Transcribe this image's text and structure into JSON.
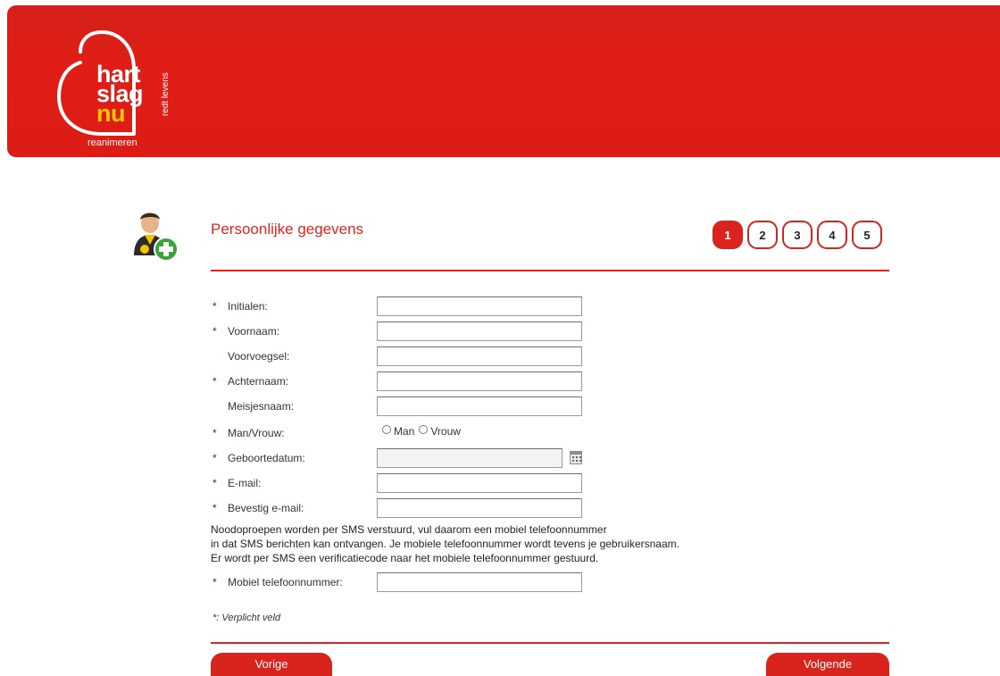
{
  "logo": {
    "line1": "hart",
    "line2": "slag",
    "line3": "nu",
    "subtitle": "reanimeren",
    "vertical": "redt levens",
    "icon": "heart-outline-logo"
  },
  "section": {
    "title": "Persoonlijke gegevens",
    "icon": "user-add-icon"
  },
  "steps": [
    "1",
    "2",
    "3",
    "4",
    "5"
  ],
  "active_step": "1",
  "form": {
    "fields": [
      {
        "required": "*",
        "label": "Initialen:",
        "value": ""
      },
      {
        "required": "*",
        "label": "Voornaam:",
        "value": ""
      },
      {
        "required": "",
        "label": "Voorvoegsel:",
        "value": ""
      },
      {
        "required": "*",
        "label": "Achternaam:",
        "value": ""
      },
      {
        "required": "",
        "label": "Meisjesnaam:",
        "value": ""
      }
    ],
    "gender": {
      "required": "*",
      "label": "Man/Vrouw:",
      "option_man": "Man",
      "option_vrouw": "Vrouw"
    },
    "birthdate": {
      "required": "*",
      "label": "Geboortedatum:",
      "value": "",
      "icon": "calendar-icon"
    },
    "email": {
      "required": "*",
      "label": "E-mail:",
      "value": ""
    },
    "email_confirm": {
      "required": "*",
      "label": "Bevestig e-mail:",
      "value": ""
    },
    "sms_note": {
      "line1": "Noodoproepen worden per SMS verstuurd, vul daarom een mobiel telefoonnummer",
      "line2": "in dat SMS berichten kan ontvangen. Je mobiele telefoonnummer wordt tevens je gebruikersnaam.",
      "line3": "Er wordt per SMS een verificatiecode naar het mobiele telefoonnummer gestuurd."
    },
    "mobile": {
      "required": "*",
      "label": "Mobiel telefoonnummer:",
      "value": ""
    },
    "required_note": "*: Verplicht veld"
  },
  "buttons": {
    "prev": "Vorige",
    "next": "Volgende"
  },
  "colors": {
    "brand_red": "#e01e17",
    "accent_yellow": "#f2c800"
  }
}
